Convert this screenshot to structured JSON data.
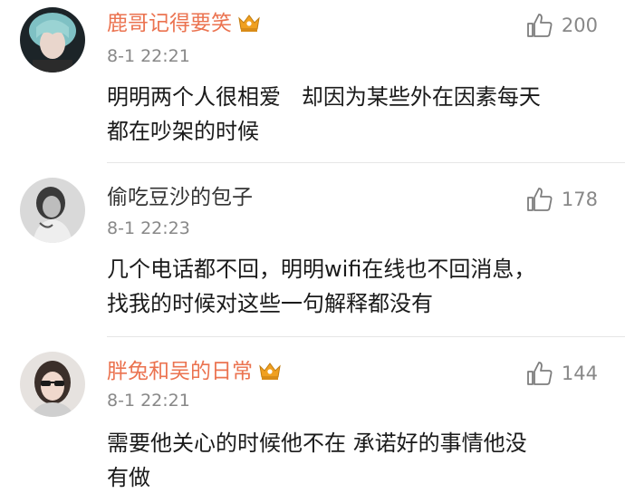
{
  "comments": [
    {
      "username": "鹿哥记得要笑",
      "vip": true,
      "time": "8-1 22:21",
      "likes": "200",
      "avatar": "avatar-teal-hair",
      "text": "明明两个人很相爱   却因为某些外在因素每天\n都在吵架的时候"
    },
    {
      "username": "偷吃豆沙的包子",
      "vip": false,
      "time": "8-1 22:23",
      "likes": "178",
      "avatar": "avatar-grayscale-person",
      "text": "几个电话都不回，明明wifi在线也不回消息，\n找我的时候对这些一句解释都没有"
    },
    {
      "username": "胖兔和吴的日常",
      "vip": true,
      "time": "8-1 22:21",
      "likes": "144",
      "avatar": "avatar-sunglasses-woman",
      "text": "需要他关心的时候他不在 承诺好的事情他没\n有做"
    }
  ],
  "icons": {
    "like": "thumbs-up-outline-icon",
    "vip_badge": "crown-badge-icon"
  },
  "colors": {
    "vip_name": "#eb7350",
    "plain_name": "#333333",
    "meta": "#888888",
    "divider": "#e6e6e6",
    "crown": "#f0a020"
  }
}
